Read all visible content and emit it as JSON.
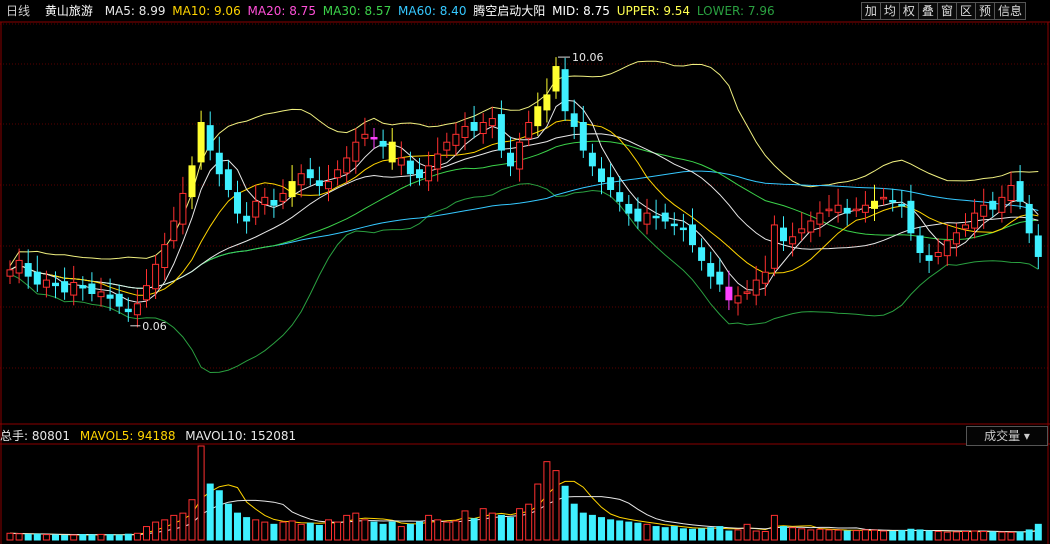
{
  "header": {
    "period": "日线",
    "stock_name": "黄山旅游",
    "indicators": [
      {
        "label": "MA5: 8.99",
        "color": "#e8e8e8"
      },
      {
        "label": "MA10: 9.06",
        "color": "#ffd400"
      },
      {
        "label": "MA20: 8.75",
        "color": "#ff4fd8"
      },
      {
        "label": "MA30: 8.57",
        "color": "#3cd24a"
      },
      {
        "label": "MA60: 8.40",
        "color": "#35c8ff"
      }
    ],
    "signal_name": "腾空启动大阳",
    "mid": "MID: 8.75",
    "upper": "UPPER: 9.54",
    "lower": "LOWER: 7.96"
  },
  "toolbar": {
    "buttons": [
      "加",
      "均",
      "权",
      "叠",
      "窗",
      "区",
      "预",
      "信息"
    ]
  },
  "volume": {
    "total": "总手: 80801",
    "mavol5": "MAVOL5: 94188",
    "mavol10": "MAVOL10: 152081",
    "indicator_select": "成交量 ▾"
  },
  "chart_data": {
    "type": "candlestick",
    "title": "黄山旅游",
    "period": "日线",
    "price_range": [
      5.6,
      10.6
    ],
    "marked_high": {
      "label": "10.06",
      "value": 10.06,
      "index": 60
    },
    "marked_low": {
      "label": "0.06",
      "index": 13
    },
    "colors": {
      "up": "#ff3030",
      "down": "#3ff0ff",
      "signal": "#ffff30",
      "signal_alt": "#ff40ff",
      "ma5": "#e8e8e8",
      "ma10": "#ffd400",
      "ma20": "#ff4fd8",
      "ma30": "#3cd24a",
      "ma60": "#35c8ff",
      "mid": "#e8e8e8",
      "upper": "#f0f080",
      "lower": "#2aa040",
      "vol_up": "#ff3030",
      "vol_down": "#3ff0ff"
    },
    "closes": [
      7.48,
      7.6,
      7.4,
      7.3,
      7.35,
      7.28,
      7.2,
      7.32,
      7.25,
      7.18,
      7.2,
      7.12,
      7.02,
      6.95,
      7.05,
      7.28,
      7.55,
      7.8,
      8.1,
      8.45,
      8.8,
      9.35,
      9.0,
      8.7,
      8.5,
      8.2,
      8.1,
      8.35,
      8.4,
      8.3,
      8.45,
      8.6,
      8.7,
      8.65,
      8.55,
      8.6,
      8.75,
      8.9,
      9.1,
      9.2,
      9.15,
      9.05,
      8.85,
      8.9,
      8.7,
      8.65,
      8.8,
      8.95,
      9.1,
      9.2,
      9.3,
      9.25,
      9.35,
      9.4,
      9.0,
      8.8,
      9.1,
      9.35,
      9.55,
      9.7,
      10.06,
      9.5,
      9.3,
      9.0,
      8.8,
      8.6,
      8.5,
      8.35,
      8.2,
      8.1,
      8.2,
      8.15,
      8.1,
      8.05,
      8.0,
      7.8,
      7.6,
      7.4,
      7.3,
      7.1,
      7.15,
      7.2,
      7.35,
      7.45,
      8.05,
      7.85,
      7.9,
      8.0,
      8.1,
      8.2,
      8.25,
      8.3,
      8.2,
      8.25,
      8.3,
      8.35,
      8.4,
      8.35,
      8.3,
      7.95,
      7.7,
      7.6,
      7.7,
      7.85,
      7.95,
      8.05,
      8.2,
      8.3,
      8.25,
      8.4,
      8.55,
      8.35,
      7.95,
      7.65
    ],
    "volumes": [
      30,
      28,
      25,
      26,
      24,
      22,
      20,
      22,
      24,
      23,
      25,
      24,
      22,
      26,
      30,
      60,
      80,
      90,
      110,
      120,
      180,
      420,
      250,
      220,
      160,
      120,
      100,
      90,
      80,
      70,
      80,
      85,
      70,
      75,
      65,
      90,
      80,
      110,
      120,
      90,
      80,
      70,
      80,
      60,
      70,
      80,
      110,
      90,
      80,
      85,
      130,
      95,
      140,
      120,
      110,
      100,
      140,
      160,
      250,
      350,
      310,
      240,
      160,
      120,
      110,
      100,
      90,
      85,
      80,
      75,
      70,
      60,
      55,
      60,
      50,
      48,
      50,
      55,
      60,
      40,
      45,
      70,
      40,
      38,
      110,
      60,
      55,
      50,
      45,
      48,
      45,
      44,
      40,
      42,
      45,
      44,
      40,
      38,
      42,
      48,
      45,
      40,
      38,
      35,
      36,
      38,
      40,
      38,
      36,
      35,
      34,
      36,
      45,
      70
    ]
  }
}
